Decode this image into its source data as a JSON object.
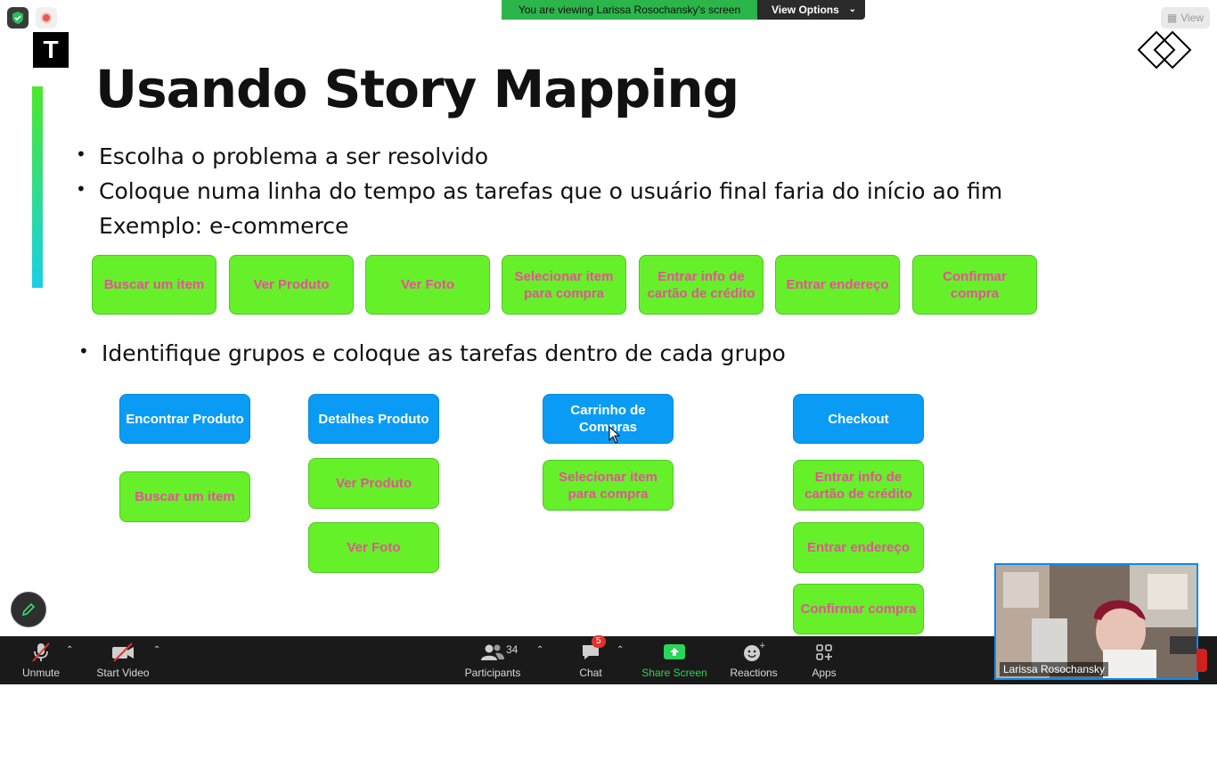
{
  "banner": {
    "message": "You are viewing Larissa Rosochansky's screen",
    "options_label": "View Options"
  },
  "view_button": "View",
  "slide": {
    "logo_letter": "T",
    "title": "Usando Story Mapping",
    "bullets": [
      "Escolha o problema a ser resolvido",
      "Coloque numa linha do tempo as tarefas que o usuário final faria do início ao fim",
      "Exemplo: e-commerce",
      "Identifique grupos e coloque as tarefas dentro de cada grupo"
    ],
    "timeline": [
      "Buscar um item",
      "Ver Produto",
      "Ver Foto",
      "Selecionar item para compra",
      "Entrar info de cartão de crédito",
      "Entrar endereço",
      "Confirmar compra"
    ],
    "groups": [
      {
        "name": "Encontrar Produto",
        "tasks": [
          "Buscar um item"
        ]
      },
      {
        "name": "Detalhes Produto",
        "tasks": [
          "Ver Produto",
          "Ver Foto"
        ]
      },
      {
        "name": "Carrinho de Compras",
        "tasks": [
          "Selecionar item para compra"
        ]
      },
      {
        "name": "Checkout",
        "tasks": [
          "Entrar info de cartão de crédito",
          "Entrar endereço",
          "Confirmar compra"
        ]
      }
    ]
  },
  "toolbar": {
    "unmute": "Unmute",
    "start_video": "Start Video",
    "participants": "Participants",
    "participants_count": "34",
    "chat": "Chat",
    "chat_badge": "5",
    "share_screen": "Share Screen",
    "reactions": "Reactions",
    "apps": "Apps"
  },
  "video": {
    "name": "Larissa Rosochansky"
  },
  "colors": {
    "task_green": "#66f02a",
    "task_text_pink": "#e8509a",
    "group_blue": "#0a9cf5",
    "share_green": "#2bd45a"
  }
}
